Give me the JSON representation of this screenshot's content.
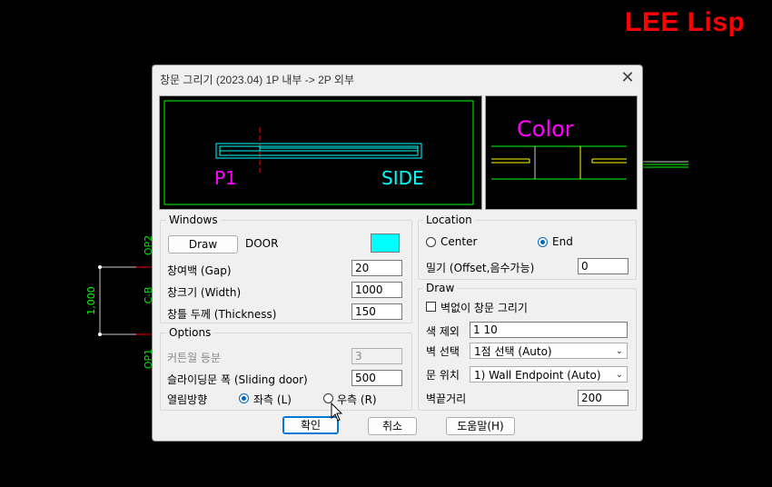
{
  "brand": "LEE Lisp",
  "window": {
    "title": "창문 그리기 (2023.04)   1P 내부 -> 2P 외부",
    "close_glyph": "✕"
  },
  "preview_left": {
    "label_left": "P1",
    "label_right": "SIDE"
  },
  "preview_right": {
    "label": "Color"
  },
  "background_cad": {
    "dimension": "1,000",
    "tags": [
      "OP2",
      "C-B",
      "OP1"
    ]
  },
  "windows_group": {
    "title": "Windows",
    "draw_button": "Draw",
    "type_label": "DOOR",
    "color_swatch": "#00ffff",
    "fields": [
      {
        "label": "창여백 (Gap)",
        "value": "20"
      },
      {
        "label": "창크기 (Width)",
        "value": "1000"
      },
      {
        "label": "창틀 두께 (Thickness)",
        "value": "150"
      }
    ]
  },
  "options_group": {
    "title": "Options",
    "curtain_label": "커튼월 등분",
    "curtain_value": "3",
    "sliding_label": "슬라이딩문 폭 (Sliding door)",
    "sliding_value": "500",
    "open_dir_label": "열림방향",
    "radio_left": "좌측 (L)",
    "radio_right": "우측 (R)",
    "selected": "left"
  },
  "location_group": {
    "title": "Location",
    "radio_center": "Center",
    "radio_end": "End",
    "selected": "end",
    "offset_label": "밀기 (Offset,음수가능)",
    "offset_value": "0"
  },
  "draw_group": {
    "title": "Draw",
    "no_wall_label": "벽없이 창문 그리기",
    "no_wall_checked": false,
    "color_exclude_label": "색 제외",
    "color_exclude_value": "1 10",
    "wall_select_label": "벽 선택",
    "wall_select_value": "1점 선택 (Auto)",
    "door_pos_label": "문 위치",
    "door_pos_value": "1) Wall Endpoint (Auto)",
    "wall_end_label": "벽끝거리",
    "wall_end_value": "200"
  },
  "footer": {
    "ok": "확인",
    "cancel": "취소",
    "help": "도움말(H)"
  },
  "colors": {
    "accent": "#0067c0",
    "brand_red": "#ff0000",
    "cad_green": "#00ff00",
    "cad_cyan": "#00ffff",
    "cad_magenta": "#ff00ff",
    "cad_yellow": "#ffff00"
  }
}
